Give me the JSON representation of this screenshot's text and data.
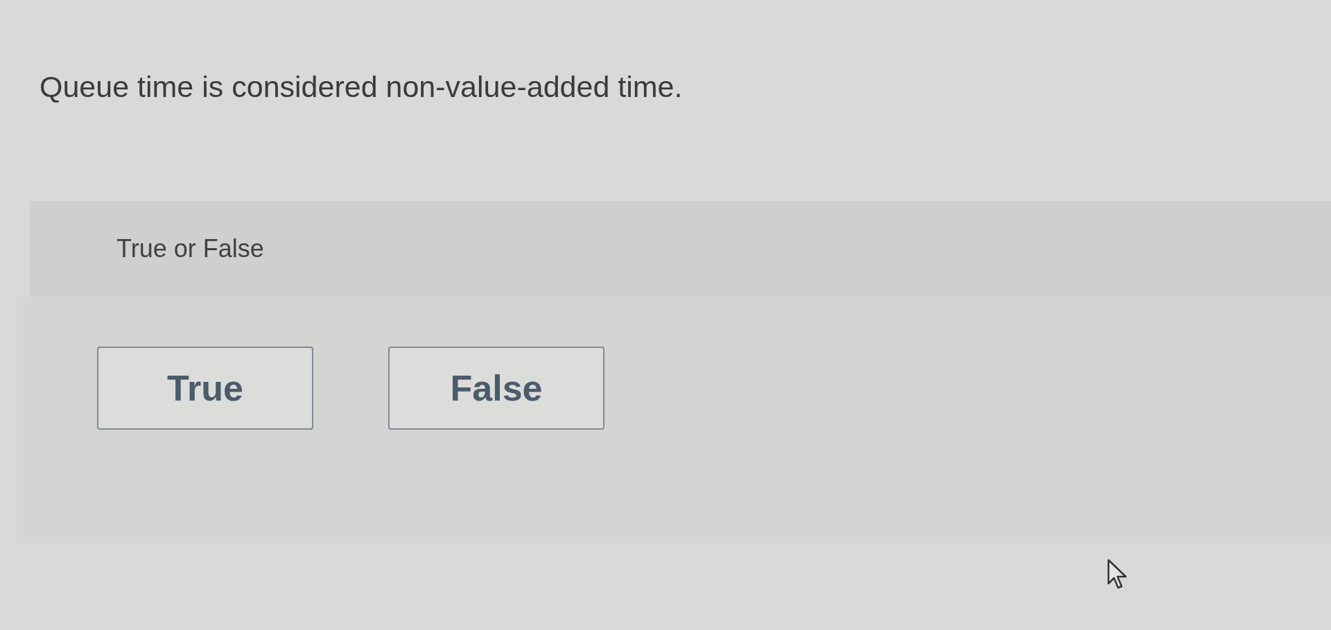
{
  "question": {
    "text": "Queue time is considered non-value-added time."
  },
  "prompt_panel": {
    "label": "True or False"
  },
  "answers": [
    {
      "label": "True"
    },
    {
      "label": "False"
    }
  ]
}
